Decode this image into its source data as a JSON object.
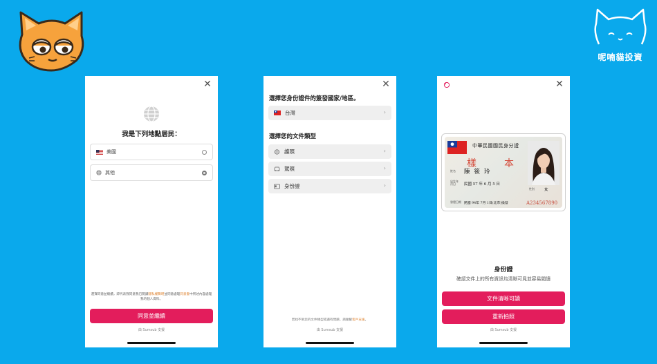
{
  "brand": {
    "name": "呢喃貓投資"
  },
  "screen1": {
    "title": "我是下列地點居民：",
    "options": [
      {
        "label": "美國",
        "selected": false
      },
      {
        "label": "其他",
        "selected": true
      }
    ],
    "consent_prefix": "選擇同意並繼續，即代表我同意我已閱讀",
    "consent_link1": "隱私權聲明",
    "consent_mid": "並同意處理",
    "consent_link2": "同意書",
    "consent_suffix": "中所述內容處理我的個人資料。",
    "primary_button": "同意並繼續",
    "powered_by": "由 Sumsub 支援"
  },
  "screen2": {
    "country_heading": "選擇您身份證件的簽發國家/地區。",
    "country": {
      "label": "台灣"
    },
    "doc_heading": "選擇您的文件類型",
    "doc_types": [
      {
        "label": "護照",
        "icon": "passport-icon"
      },
      {
        "label": "駕照",
        "icon": "driver-license-icon"
      },
      {
        "label": "身份證",
        "icon": "id-card-icon"
      }
    ],
    "help_prefix": "若找不到您的文件類型或遇有問題，請聯繫",
    "help_link": "客戶支援",
    "help_suffix": "。",
    "powered_by": "由 Sumsub 支援"
  },
  "screen3": {
    "card": {
      "title": "中華民國國民身分證",
      "sample_chars": [
        "樣",
        "本"
      ],
      "name_label": "姓名",
      "name": "陳筱玲",
      "birth_label": "出生年月日",
      "birth": "民國 57 年 6 月 5 日",
      "sex_label": "性別",
      "sex": "女",
      "issue_label": "發證日期",
      "issue": "民國 94年 7月 1日(北市)換發",
      "number": "A234567890"
    },
    "title": "身份證",
    "subtitle": "確認文件上的所有資訊均清晰可見並容易閱讀",
    "confirm_button": "文件清晰可讀",
    "retake_button": "重新拍照",
    "powered_by": "由 Sumsub 支援"
  },
  "colors": {
    "background": "#0aa9ec",
    "primary": "#e31d5c",
    "link": "#e0893a"
  }
}
